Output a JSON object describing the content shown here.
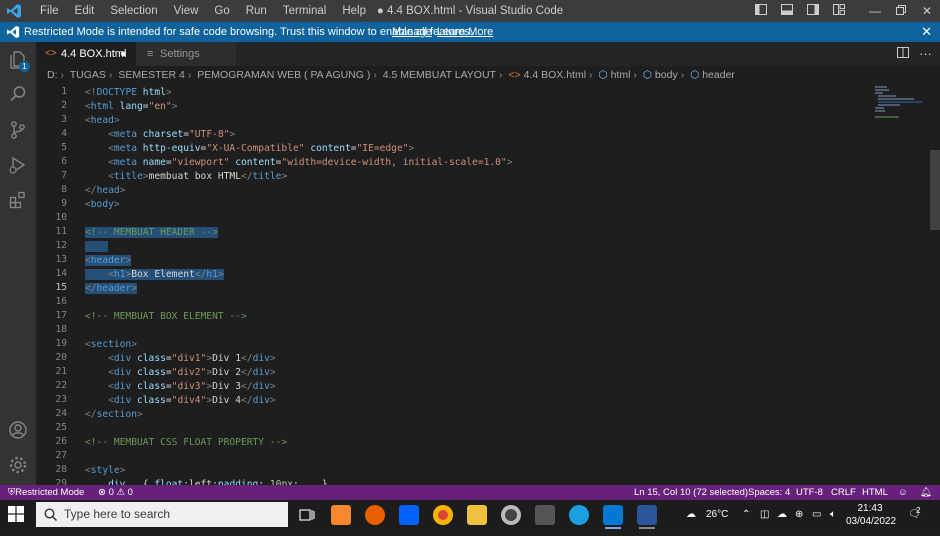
{
  "window": {
    "title": "● 4.4 BOX.html - Visual Studio Code",
    "menu": [
      "File",
      "Edit",
      "Selection",
      "View",
      "Go",
      "Run",
      "Terminal",
      "Help"
    ]
  },
  "banner": {
    "message": "Restricted Mode is intended for safe code browsing. Trust this window to enable all features.",
    "manage": "Manage",
    "learn_more": "Learn More"
  },
  "activity_bar": {
    "badge": "1",
    "items": [
      "explorer-icon",
      "search-icon",
      "source-control-icon",
      "run-debug-icon",
      "extensions-icon",
      "account-icon",
      "gear-icon"
    ]
  },
  "tabs": [
    {
      "label": "4.4 BOX.html",
      "dirty": "●"
    },
    {
      "label": "Settings"
    }
  ],
  "breadcrumb": [
    "D:",
    "TUGAS",
    "SEMESTER 4",
    "PEMOGRAMAN WEB ( PA AGUNG )",
    "4.5 MEMBUAT LAYOUT",
    "4.4 BOX.html",
    "html",
    "body",
    "header"
  ],
  "editor": {
    "current_line": 15,
    "selected_lines": [
      11,
      12,
      13,
      14,
      15
    ],
    "lines": [
      [
        [
          "punc",
          "<!"
        ],
        [
          "tag",
          "DOCTYPE"
        ],
        [
          "text",
          " "
        ],
        [
          "attr",
          "html"
        ],
        [
          "punc",
          ">"
        ]
      ],
      [
        [
          "punc",
          "<"
        ],
        [
          "tag",
          "html"
        ],
        [
          "text",
          " "
        ],
        [
          "attr",
          "lang"
        ],
        [
          "text",
          "="
        ],
        [
          "str",
          "\"en\""
        ],
        [
          "punc",
          ">"
        ]
      ],
      [
        [
          "punc",
          "<"
        ],
        [
          "tag",
          "head"
        ],
        [
          "punc",
          ">"
        ]
      ],
      [
        [
          "text",
          "    "
        ],
        [
          "punc",
          "<"
        ],
        [
          "tag",
          "meta"
        ],
        [
          "text",
          " "
        ],
        [
          "attr",
          "charset"
        ],
        [
          "text",
          "="
        ],
        [
          "str",
          "\"UTF-8\""
        ],
        [
          "punc",
          ">"
        ]
      ],
      [
        [
          "text",
          "    "
        ],
        [
          "punc",
          "<"
        ],
        [
          "tag",
          "meta"
        ],
        [
          "text",
          " "
        ],
        [
          "attr",
          "http-equiv"
        ],
        [
          "text",
          "="
        ],
        [
          "str",
          "\"X-UA-Compatible\""
        ],
        [
          "text",
          " "
        ],
        [
          "attr",
          "content"
        ],
        [
          "text",
          "="
        ],
        [
          "str",
          "\"IE=edge\""
        ],
        [
          "punc",
          ">"
        ]
      ],
      [
        [
          "text",
          "    "
        ],
        [
          "punc",
          "<"
        ],
        [
          "tag",
          "meta"
        ],
        [
          "text",
          " "
        ],
        [
          "attr",
          "name"
        ],
        [
          "text",
          "="
        ],
        [
          "str",
          "\"viewport\""
        ],
        [
          "text",
          " "
        ],
        [
          "attr",
          "content"
        ],
        [
          "text",
          "="
        ],
        [
          "str",
          "\"width=device-width, initial-scale=1.0\""
        ],
        [
          "punc",
          ">"
        ]
      ],
      [
        [
          "text",
          "    "
        ],
        [
          "punc",
          "<"
        ],
        [
          "tag",
          "title"
        ],
        [
          "punc",
          ">"
        ],
        [
          "text",
          "membuat box HTML"
        ],
        [
          "punc",
          "</"
        ],
        [
          "tag",
          "title"
        ],
        [
          "punc",
          ">"
        ]
      ],
      [
        [
          "punc",
          "</"
        ],
        [
          "tag",
          "head"
        ],
        [
          "punc",
          ">"
        ]
      ],
      [
        [
          "punc",
          "<"
        ],
        [
          "tag",
          "body"
        ],
        [
          "punc",
          ">"
        ]
      ],
      [],
      [
        [
          "cmt",
          "<!-- MEMBUAT HEADER -->"
        ]
      ],
      [
        [
          "text",
          "    "
        ]
      ],
      [
        [
          "punc",
          "<"
        ],
        [
          "tag",
          "header"
        ],
        [
          "punc",
          ">"
        ]
      ],
      [
        [
          "text",
          "    "
        ],
        [
          "punc",
          "<"
        ],
        [
          "tag",
          "h1"
        ],
        [
          "punc",
          ">"
        ],
        [
          "text",
          "Box Element"
        ],
        [
          "punc",
          "</"
        ],
        [
          "tag",
          "h1"
        ],
        [
          "punc",
          ">"
        ]
      ],
      [
        [
          "punc",
          "</"
        ],
        [
          "tag",
          "header"
        ],
        [
          "punc",
          ">"
        ]
      ],
      [],
      [
        [
          "cmt",
          "<!-- MEMBUAT BOX ELEMENT -->"
        ]
      ],
      [],
      [
        [
          "punc",
          "<"
        ],
        [
          "tag",
          "section"
        ],
        [
          "punc",
          ">"
        ]
      ],
      [
        [
          "text",
          "    "
        ],
        [
          "punc",
          "<"
        ],
        [
          "tag",
          "div"
        ],
        [
          "text",
          " "
        ],
        [
          "attr",
          "class"
        ],
        [
          "text",
          "="
        ],
        [
          "str",
          "\"div1\""
        ],
        [
          "punc",
          ">"
        ],
        [
          "text",
          "Div 1"
        ],
        [
          "punc",
          "</"
        ],
        [
          "tag",
          "div"
        ],
        [
          "punc",
          ">"
        ]
      ],
      [
        [
          "text",
          "    "
        ],
        [
          "punc",
          "<"
        ],
        [
          "tag",
          "div"
        ],
        [
          "text",
          " "
        ],
        [
          "attr",
          "class"
        ],
        [
          "text",
          "="
        ],
        [
          "str",
          "\"div2\""
        ],
        [
          "punc",
          ">"
        ],
        [
          "text",
          "Div 2"
        ],
        [
          "punc",
          "</"
        ],
        [
          "tag",
          "div"
        ],
        [
          "punc",
          ">"
        ]
      ],
      [
        [
          "text",
          "    "
        ],
        [
          "punc",
          "<"
        ],
        [
          "tag",
          "div"
        ],
        [
          "text",
          " "
        ],
        [
          "attr",
          "class"
        ],
        [
          "text",
          "="
        ],
        [
          "str",
          "\"div3\""
        ],
        [
          "punc",
          ">"
        ],
        [
          "text",
          "Div 3"
        ],
        [
          "punc",
          "</"
        ],
        [
          "tag",
          "div"
        ],
        [
          "punc",
          ">"
        ]
      ],
      [
        [
          "text",
          "    "
        ],
        [
          "punc",
          "<"
        ],
        [
          "tag",
          "div"
        ],
        [
          "text",
          " "
        ],
        [
          "attr",
          "class"
        ],
        [
          "text",
          "="
        ],
        [
          "str",
          "\"div4\""
        ],
        [
          "punc",
          ">"
        ],
        [
          "text",
          "Div 4"
        ],
        [
          "punc",
          "</"
        ],
        [
          "tag",
          "div"
        ],
        [
          "punc",
          ">"
        ]
      ],
      [
        [
          "punc",
          "</"
        ],
        [
          "tag",
          "section"
        ],
        [
          "punc",
          ">"
        ]
      ],
      [],
      [
        [
          "cmt",
          "<!-- MEMBUAT CSS FLOAT PROPERTY -->"
        ]
      ],
      [],
      [
        [
          "punc",
          "<"
        ],
        [
          "tag",
          "style"
        ],
        [
          "punc",
          ">"
        ]
      ],
      [
        [
          "text",
          "    "
        ],
        [
          "attr",
          "div"
        ],
        [
          "text",
          "   { "
        ],
        [
          "prop",
          "float"
        ],
        [
          "text",
          ":"
        ],
        [
          "text",
          "left"
        ],
        [
          "text",
          ";"
        ],
        [
          "prop",
          "padding"
        ],
        [
          "text",
          ": "
        ],
        [
          "num",
          "10px"
        ],
        [
          "text",
          ";    }"
        ]
      ]
    ]
  },
  "status_bar": {
    "restricted": "Restricted Mode",
    "problems": "⊗ 0 ⚠ 0",
    "position": "Ln 15, Col 10 (72 selected)",
    "spaces": "Spaces: 4",
    "encoding": "UTF-8",
    "eol": "CRLF",
    "language": "HTML"
  },
  "taskbar": {
    "search_placeholder": "Type here to search",
    "weather": "26°C",
    "time": "21:43",
    "date": "03/04/2022",
    "notifications": "2"
  },
  "colors": {
    "editor_bg": "#1e1e1e",
    "status_bar": "#68217a",
    "banner": "#0e639c",
    "selection": "#264f78"
  }
}
